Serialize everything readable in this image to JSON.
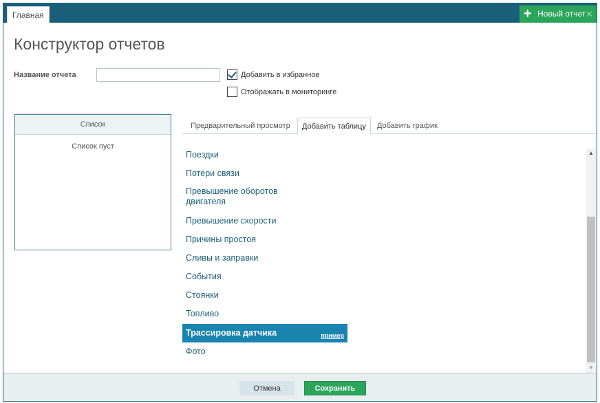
{
  "topbar": {
    "home_tab": "Главная",
    "new_report_label": "Новый отчет"
  },
  "page_title": "Конструктор отчетов",
  "form": {
    "name_label": "Название отчета",
    "name_value": "",
    "favorites_label": "Добавить в избранное",
    "favorites_checked": true,
    "monitoring_label": "Отображать в мониторинге",
    "monitoring_checked": false
  },
  "list_panel": {
    "header": "Список",
    "empty_text": "Список пуст"
  },
  "tabs": [
    {
      "label": "Предварительный просмотр",
      "active": false
    },
    {
      "label": "Добавить таблицу",
      "active": true
    },
    {
      "label": "Добавить график",
      "active": false
    }
  ],
  "report_types": [
    {
      "label": "Поездки"
    },
    {
      "label": "Потери связи"
    },
    {
      "label": "Превышение оборотов двигателя"
    },
    {
      "label": "Превышение скорости"
    },
    {
      "label": "Причины простоя"
    },
    {
      "label": "Сливы и заправки"
    },
    {
      "label": "События"
    },
    {
      "label": "Стоянки"
    },
    {
      "label": "Топливо"
    },
    {
      "label": "Трассировка датчика",
      "selected": true,
      "example_link": "пример"
    },
    {
      "label": "Фото"
    }
  ],
  "footer": {
    "cancel_label": "Отмена",
    "save_label": "Сохранить"
  },
  "colors": {
    "accent": "#1a5f7a",
    "success": "#2aa55a",
    "selected_row": "#1a84b0"
  }
}
